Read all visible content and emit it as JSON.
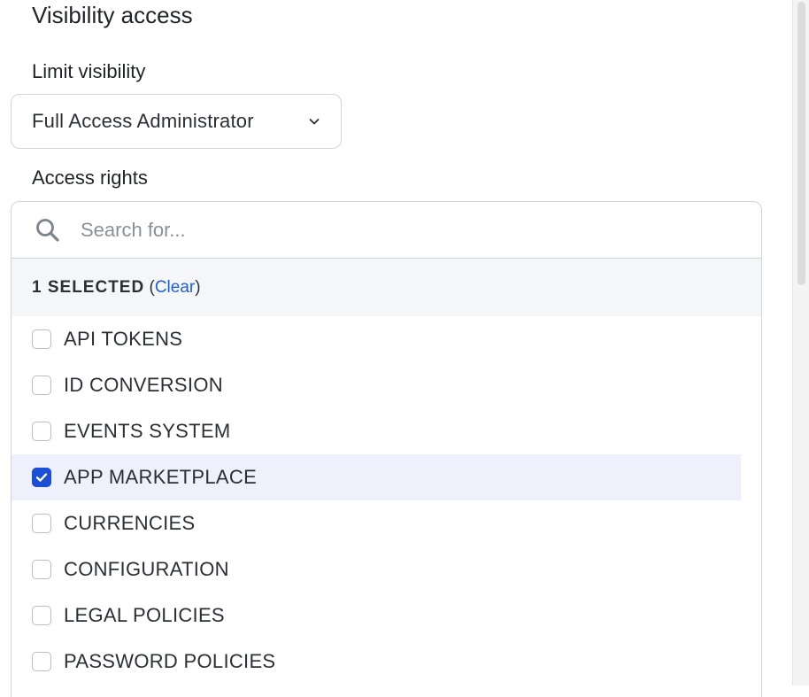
{
  "section": {
    "title": "Visibility access"
  },
  "limit_visibility": {
    "label": "Limit visibility",
    "selected_value": "Full Access Administrator"
  },
  "access_rights": {
    "label": "Access rights",
    "search": {
      "placeholder": "Search for...",
      "value": ""
    },
    "selection_summary": {
      "count_text": "1 SELECTED",
      "open_paren": "(",
      "clear_label": "Clear",
      "close_paren": ")"
    },
    "options": [
      {
        "label": "API TOKENS",
        "checked": false
      },
      {
        "label": "ID CONVERSION",
        "checked": false
      },
      {
        "label": "EVENTS SYSTEM",
        "checked": false
      },
      {
        "label": "APP MARKETPLACE",
        "checked": true
      },
      {
        "label": "CURRENCIES",
        "checked": false
      },
      {
        "label": "CONFIGURATION",
        "checked": false
      },
      {
        "label": "LEGAL POLICIES",
        "checked": false
      },
      {
        "label": "PASSWORD POLICIES",
        "checked": false
      }
    ]
  },
  "colors": {
    "accent": "#1a4fd6",
    "link": "#1f5fd6",
    "selected_row_bg": "#eef1fb",
    "border": "#d0d4da"
  },
  "icons": {
    "search": "search-icon",
    "dropdown": "chevron-down-icon",
    "check": "checkmark-icon"
  }
}
